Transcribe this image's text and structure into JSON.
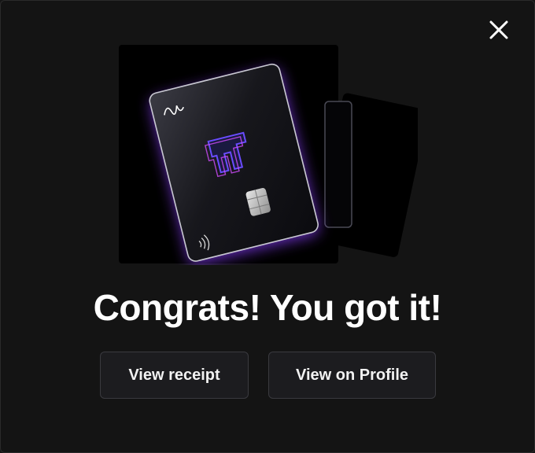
{
  "modal": {
    "close_icon": "close-icon",
    "title": "Congrats! You got it!",
    "buttons": {
      "receipt_label": "View receipt",
      "profile_label": "View on Profile"
    },
    "card_art": {
      "accent_color": "#8a3cff",
      "icons": [
        "signature-logo-icon",
        "brand-m-logo-icon",
        "chip-icon",
        "contactless-icon"
      ]
    }
  }
}
